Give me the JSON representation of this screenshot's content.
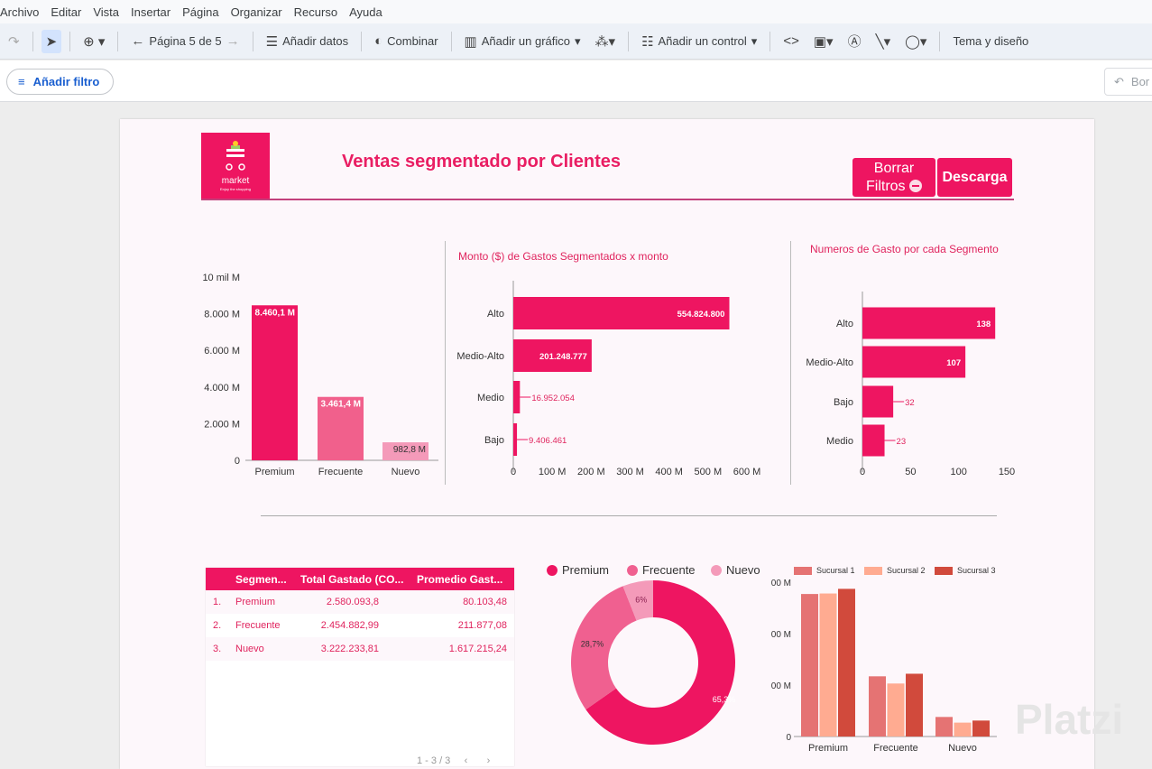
{
  "menu": [
    "Archivo",
    "Editar",
    "Vista",
    "Insertar",
    "Página",
    "Organizar",
    "Recurso",
    "Ayuda"
  ],
  "toolbar": {
    "page": "Página 5 de 5",
    "add_data": "Añadir datos",
    "blend": "Combinar",
    "add_chart": "Añadir un gráfico",
    "add_control": "Añadir un control",
    "theme": "Tema y diseño"
  },
  "filterbar": {
    "add_filter": "Añadir filtro",
    "reset": "Bor"
  },
  "report": {
    "logo_text": "market",
    "logo_sub": "Enjoy the shopping",
    "title": "Ventas segmentado por Clientes",
    "clear_filters_1": "Borrar",
    "clear_filters_2": "Filtros",
    "download": "Descarga",
    "watermark": "Platzi"
  },
  "colors": {
    "accent": "#ee1561",
    "mid": "#f1608c",
    "light": "#f49ab9"
  },
  "chart_data": [
    {
      "type": "bar",
      "title": "",
      "categories": [
        "Premium",
        "Frecuente",
        "Nuevo"
      ],
      "values": [
        8460.1,
        3461.4,
        982.8
      ],
      "labels": [
        "8.460,1 M",
        "3.461,4 M",
        "982,8 M"
      ],
      "yticks": [
        "0",
        "2.000 M",
        "4.000 M",
        "6.000 M",
        "8.000 M",
        "10 mil M"
      ],
      "ylim": [
        0,
        10000
      ],
      "unit": "M"
    },
    {
      "type": "bar",
      "orientation": "horizontal",
      "title": "Monto ($) de Gastos Segmentados x monto",
      "categories": [
        "Alto",
        "Medio-Alto",
        "Medio",
        "Bajo"
      ],
      "values": [
        554824800,
        201248777,
        16952054,
        9406461
      ],
      "labels": [
        "554.824.800",
        "201.248.777",
        "16.952.054",
        "9.406.461"
      ],
      "xticks": [
        "0",
        "100 M",
        "200 M",
        "300 M",
        "400 M",
        "500 M",
        "600 M"
      ],
      "xlim": [
        0,
        600000000
      ]
    },
    {
      "type": "bar",
      "orientation": "horizontal",
      "title": "Numeros de Gasto por cada Segmento",
      "categories": [
        "Alto",
        "Medio-Alto",
        "Bajo",
        "Medio"
      ],
      "values": [
        138,
        107,
        32,
        23
      ],
      "labels": [
        "138",
        "107",
        "32",
        "23"
      ],
      "xticks": [
        "0",
        "50",
        "100",
        "150"
      ],
      "xlim": [
        0,
        150
      ]
    },
    {
      "type": "table",
      "columns": [
        "Segmen...",
        "Total Gastado (CO...",
        "Promedio Gast..."
      ],
      "rows": [
        [
          "1.",
          "Premium",
          "2.580.093,8",
          "80.103,48"
        ],
        [
          "2.",
          "Frecuente",
          "2.454.882,99",
          "211.877,08"
        ],
        [
          "3.",
          "Nuevo",
          "3.222.233,81",
          "1.617.215,24"
        ]
      ],
      "pager": "1 - 3 / 3"
    },
    {
      "type": "pie",
      "donut": true,
      "categories": [
        "Premium",
        "Frecuente",
        "Nuevo"
      ],
      "values": [
        65.3,
        28.7,
        6
      ],
      "labels": [
        "65,3%",
        "28,7%",
        "6%"
      ],
      "legend": "top"
    },
    {
      "type": "bar",
      "categories": [
        "Premium",
        "Frecuente",
        "Nuevo"
      ],
      "series": [
        {
          "name": "Sucursal 1",
          "color": "#e57373",
          "values": [
            2.77,
            1.17,
            0.38
          ]
        },
        {
          "name": "Sucursal 2",
          "color": "#ffab91",
          "values": [
            2.78,
            1.03,
            0.27
          ]
        },
        {
          "name": "Sucursal 3",
          "color": "#d14a3c",
          "values": [
            2.87,
            1.22,
            0.31
          ]
        }
      ],
      "yticks": [
        "0",
        "00 M",
        "00 M",
        "00 M"
      ],
      "ylim": [
        0,
        3
      ],
      "legend": "top"
    }
  ]
}
